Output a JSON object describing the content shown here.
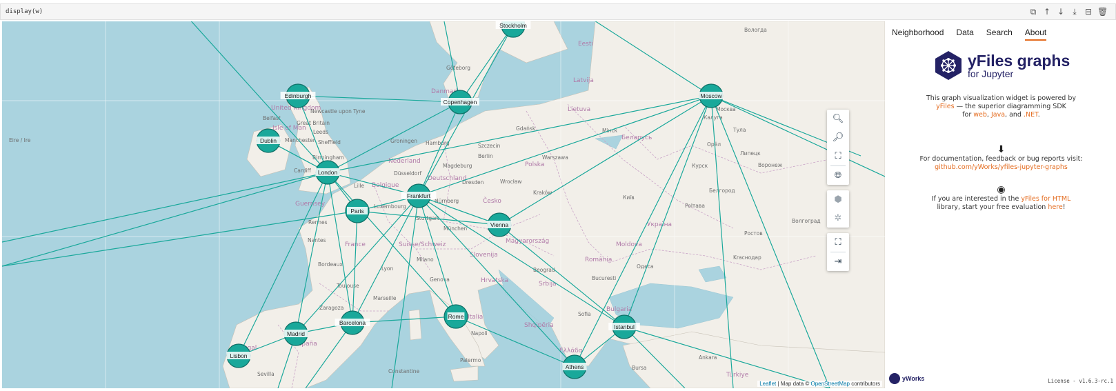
{
  "cell": {
    "code": "display(w)",
    "toolbar_icons": [
      "copy-icon",
      "move-up-icon",
      "move-down-icon",
      "insert-below-icon",
      "format-icon",
      "delete-icon"
    ]
  },
  "graph": {
    "edge_color": "#1aa89b",
    "node_color": "#19a89a",
    "nodes": [
      {
        "id": "stockholm",
        "label": "Stockholm"
      },
      {
        "id": "edinburgh",
        "label": "Edinburgh"
      },
      {
        "id": "copenhagen",
        "label": "Copenhagen"
      },
      {
        "id": "moscow",
        "label": "Moscow"
      },
      {
        "id": "dublin",
        "label": "Dublin"
      },
      {
        "id": "london",
        "label": "London"
      },
      {
        "id": "frankfurt",
        "label": "Frankfurt"
      },
      {
        "id": "paris",
        "label": "Paris"
      },
      {
        "id": "vienna",
        "label": "Vienna"
      },
      {
        "id": "rome",
        "label": "Rome"
      },
      {
        "id": "istanbul",
        "label": "Istanbul"
      },
      {
        "id": "barcelona",
        "label": "Barcelona"
      },
      {
        "id": "madrid",
        "label": "Madrid"
      },
      {
        "id": "lisbon",
        "label": "Lisbon"
      },
      {
        "id": "athens",
        "label": "Athens"
      }
    ]
  },
  "map": {
    "place_labels": [
      "Dublin",
      "Eire / Ire",
      "Belfast",
      "Isle of Man",
      "United Kingdom",
      "Great Britain",
      "Newcastle upon Tyne",
      "Leeds",
      "Manchester",
      "Sheffield",
      "Birmingham",
      "Cardiff",
      "Guernsey",
      "Rennes",
      "Nantes",
      "France",
      "Lille",
      "Belgique",
      "Nederland",
      "Groningen",
      "Hamburg",
      "Danmark",
      "Göteborg",
      "Gdańsk",
      "Szczecin",
      "Polska",
      "Warszawa",
      "Berlin",
      "Magdeburg",
      "Düsseldorf",
      "Deutschland",
      "Dresden",
      "Wrocław",
      "Česko",
      "Kraków",
      "Luxembourg",
      "Nürnberg",
      "Stuttgart",
      "München",
      "Suisse/Schweiz",
      "Genova",
      "Milano",
      "Italia",
      "Slovenija",
      "Hrvatska",
      "Srbija",
      "Magyarország",
      "România",
      "Bucuresti",
      "Moldova",
      "Україна",
      "Polтава",
      "Одеса",
      "Київ",
      "Беларусь",
      "Мінск",
      "Lietuva",
      "Latvija",
      "Eesti",
      "Вологда",
      "Москва",
      "Калуга",
      "Тула",
      "Орёл",
      "Курск",
      "Белгород",
      "Воронеж",
      "Липецк",
      "Волгоград",
      "Ростов",
      "Kraснодар",
      "Bulgaria",
      "Sofia",
      "Beograd",
      "Shqipëria",
      "Ελλάδα",
      "Bursa",
      "Ankara",
      "Türkiye",
      "Palermo",
      "Napoli",
      "Marseille",
      "Zaragoza",
      "España",
      "Portugal",
      "Sevilla",
      "Constantine",
      "Toulouse",
      "Bordeaux",
      "Lyon"
    ],
    "attribution_leaflet": "Leaflet",
    "attribution_mid": " | Map data © ",
    "attribution_osm": "OpenStreetMap",
    "attribution_end": " contributors"
  },
  "controls": {
    "zoom_in_icon": "zoom-in-icon",
    "zoom_out_icon": "zoom-out-icon",
    "fit_icon": "fit-content-icon",
    "globe_icon": "globe-icon",
    "layout_icon": "layout-icon",
    "layout2_icon": "hierarchy-icon",
    "fullscreen_icon": "fullscreen-icon",
    "sidebar_icon": "sidebar-toggle-icon"
  },
  "panel": {
    "tabs": [
      "Neighborhood",
      "Data",
      "Search",
      "About"
    ],
    "active_tab": "About",
    "logo_title": "yFiles graphs",
    "logo_subtitle": "for Jupyter",
    "powered_line1": "This graph visualization widget is powered by",
    "powered_link": "yFiles",
    "powered_line2": " — the superior diagramming SDK",
    "powered_for": "for ",
    "web": "web",
    "sep1": ", ",
    "java": "Java",
    "sep2": ", and ",
    "net": ".NET",
    "period": ".",
    "doc_line": "For documentation, feedback or bug reports visit:",
    "doc_link": "github.com/yWorks/yfiles-jupyter-graphs",
    "interest_pre": "If you are interested in the ",
    "interest_link": "yFiles for HTML",
    "interest_line2_pre": "library, start your free evaluation ",
    "here": "here",
    "excl": "!",
    "footer_brand": "yWorks",
    "license": "License - v1.6.3-rc.1"
  }
}
